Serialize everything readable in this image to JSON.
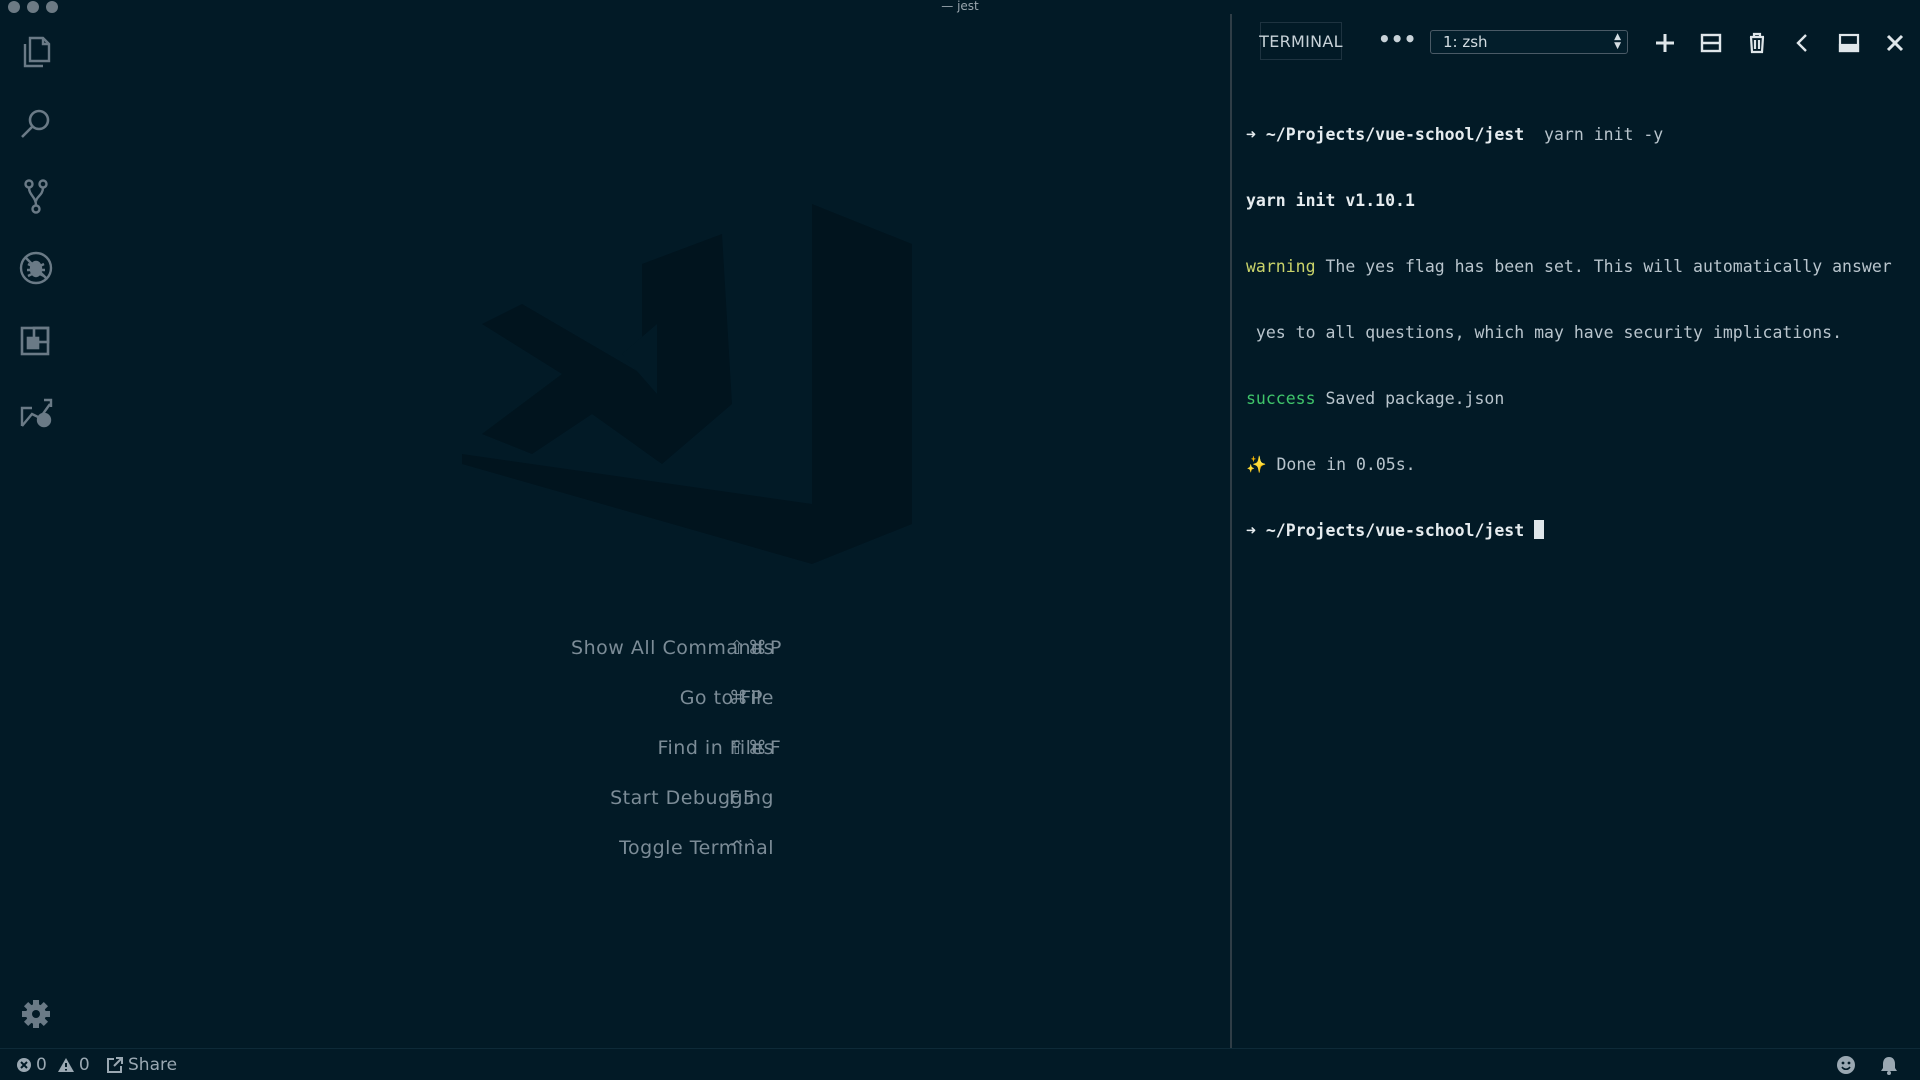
{
  "window": {
    "title": "— jest"
  },
  "activity_bar": {
    "items": [
      {
        "icon": "files-icon"
      },
      {
        "icon": "search-icon"
      },
      {
        "icon": "source-control-icon"
      },
      {
        "icon": "debug-icon"
      },
      {
        "icon": "extensions-icon"
      },
      {
        "icon": "live-share-icon"
      }
    ],
    "settings_icon": "gear-icon"
  },
  "editor": {
    "shortcuts": [
      {
        "label": "Show All Commands",
        "keys": "⇧⌘P"
      },
      {
        "label": "Go to File",
        "keys": "⌘P"
      },
      {
        "label": "Find in Files",
        "keys": "⇧⌘F"
      },
      {
        "label": "Start Debugging",
        "keys": "F5"
      },
      {
        "label": "Toggle Terminal",
        "keys": "^`"
      }
    ]
  },
  "terminal": {
    "tab_label": "TERMINAL",
    "more_label": "•••",
    "selected_shell": "1: zsh",
    "lines": {
      "l1_path": "~/Projects/vue-school/jest",
      "l1_cmd": "yarn init -y",
      "l2": "yarn init v1.10.1",
      "l3_tag": "warning",
      "l3_text": "The yes flag has been set. This will automatically answer",
      "l4": " yes to all questions, which may have security implications.",
      "l5_tag": "success",
      "l5_text": "Saved package.json",
      "l6_text": "Done in 0.05s.",
      "l7_path": "~/Projects/vue-school/jest",
      "prompt_arrow": "➜",
      "sparkle": "✨"
    }
  },
  "status_bar": {
    "errors": "0",
    "warnings": "0",
    "share_label": "Share"
  },
  "colors": {
    "background": "#021a26",
    "prompt_green": "#3fc46a",
    "warning_yellow": "#c9d36a"
  }
}
